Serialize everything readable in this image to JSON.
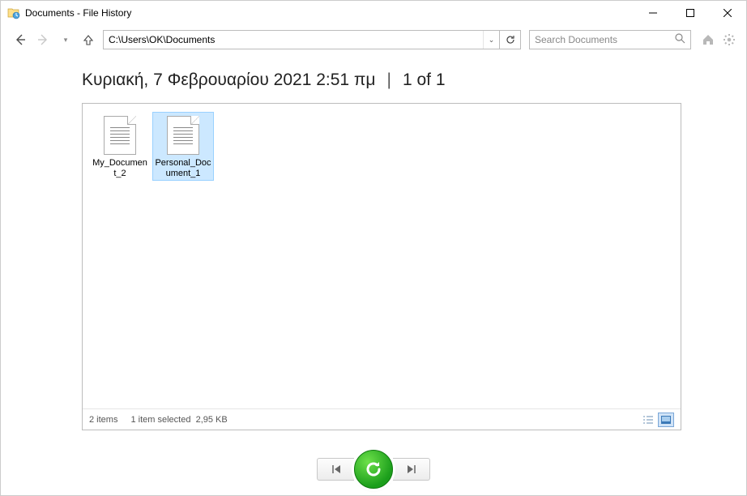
{
  "window": {
    "title": "Documents - File History"
  },
  "nav": {
    "path": "C:\\Users\\OK\\Documents",
    "search_placeholder": "Search Documents"
  },
  "header": {
    "date": "Κυριακή, 7 Φεβρουαρίου 2021 2:51 πμ",
    "position": "1 of 1"
  },
  "files": [
    {
      "name": "My_Document_2",
      "selected": false
    },
    {
      "name": "Personal_Document_1",
      "selected": true
    }
  ],
  "status": {
    "items": "2 items",
    "selected": "1 item selected",
    "size": "2,95 KB"
  }
}
